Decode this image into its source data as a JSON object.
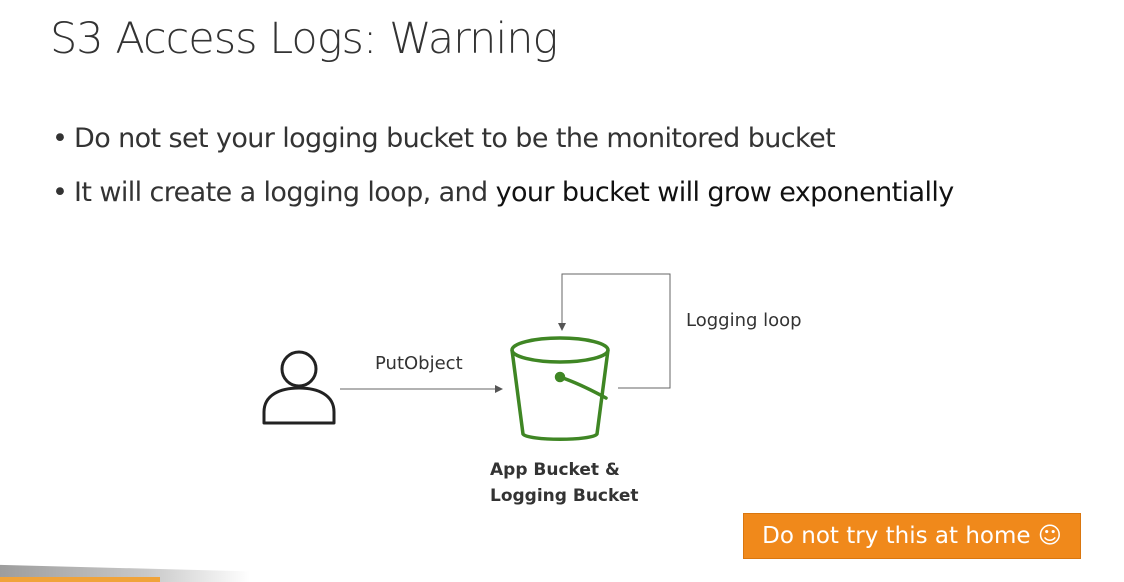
{
  "slide": {
    "title": "S3 Access Logs: Warning",
    "bullets": [
      {
        "text": "Do not set your logging bucket to be the monitored bucket"
      },
      {
        "text": "It will create a logging loop, and ",
        "emphasis": "your bucket will grow exponentially"
      }
    ]
  },
  "diagram": {
    "arrow_label": "PutObject",
    "loop_label": "Logging loop",
    "bucket_label_line1": "App Bucket &",
    "bucket_label_line2": "Logging Bucket",
    "bucket_color": "#3f8624",
    "user_icon": "user-icon",
    "bucket_icon": "s3-bucket-icon"
  },
  "callout": {
    "text": "Do not try this at home ☺",
    "color": "#f0891b"
  }
}
